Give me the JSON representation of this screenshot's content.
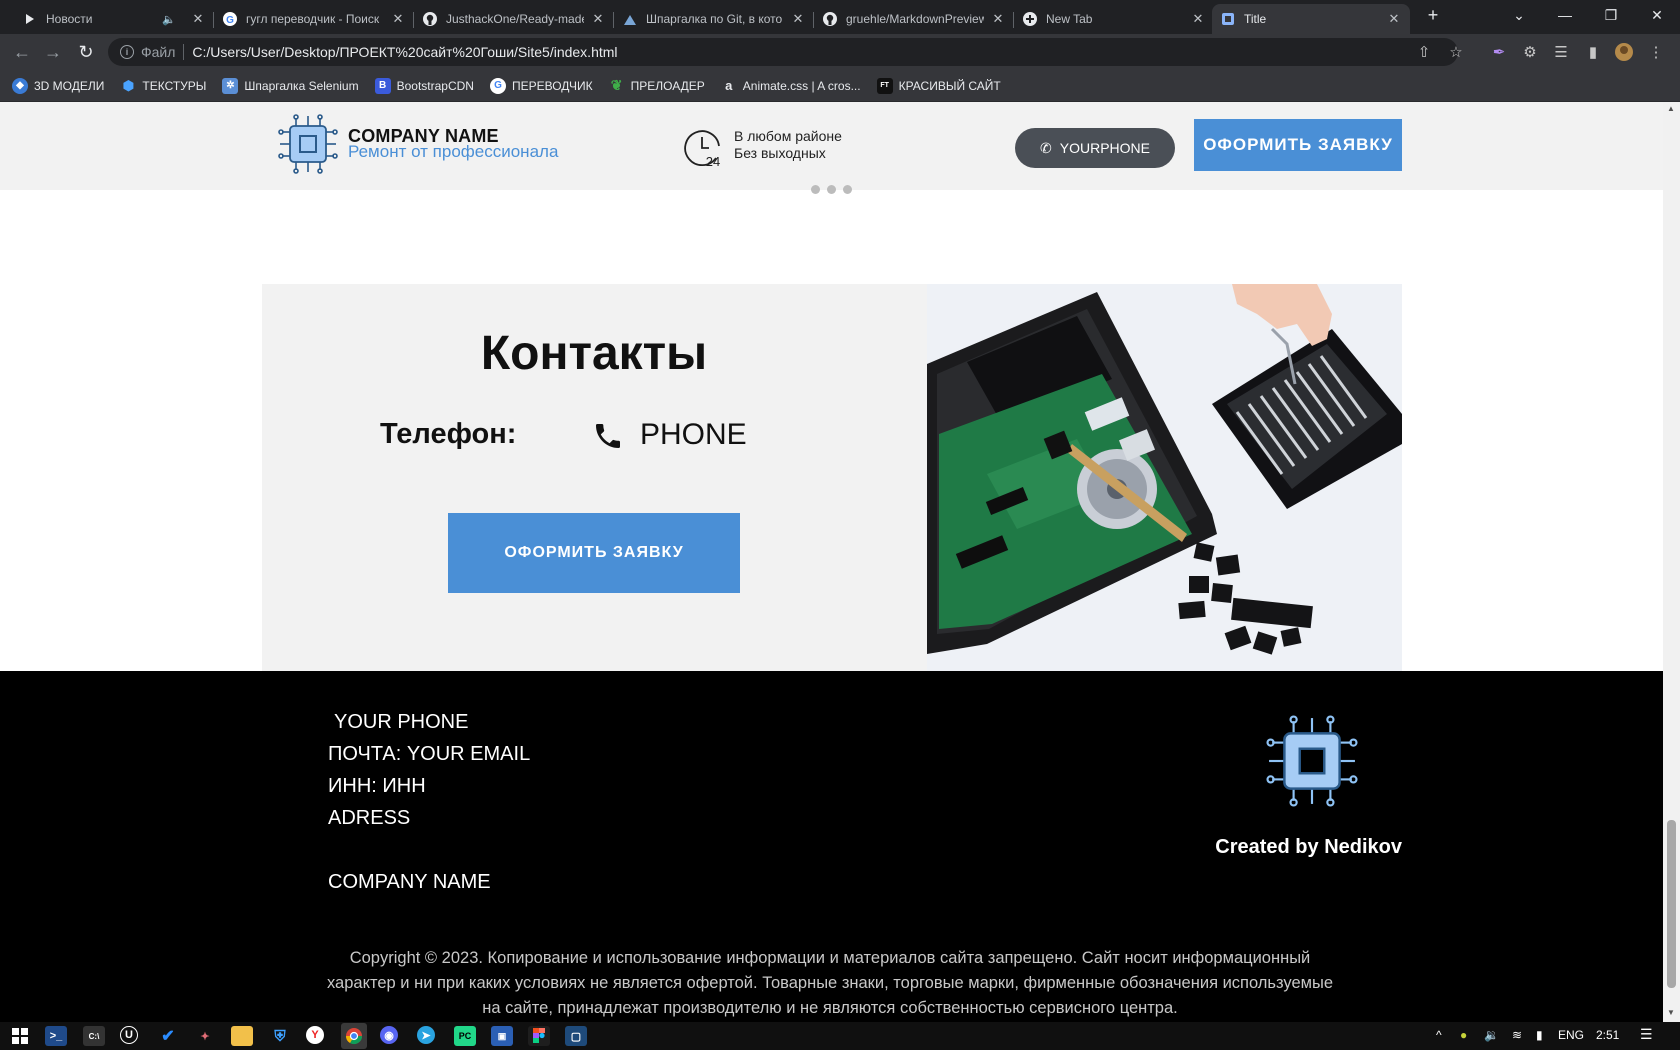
{
  "browser": {
    "tabs": [
      {
        "title": "Новости",
        "icon": "play-icon",
        "muted": true
      },
      {
        "title": "гугл переводчик - Поиск",
        "icon": "google-icon"
      },
      {
        "title": "JusthackOne/Ready-made",
        "icon": "github-icon"
      },
      {
        "title": "Шпаргалка по Git, в кото",
        "icon": "git-icon"
      },
      {
        "title": "gruehle/MarkdownPreview",
        "icon": "github-icon"
      },
      {
        "title": "New Tab",
        "icon": "new-tab-icon"
      },
      {
        "title": "Title",
        "icon": "page-icon",
        "active": true
      }
    ],
    "address": {
      "scheme_label": "Файл",
      "url": "C:/Users/User/Desktop/ПРОЕКТ%20сайт%20Гоши/Site5/index.html"
    },
    "bookmarks": [
      {
        "label": "3D МОДЕЛИ",
        "icon": "3d-icon"
      },
      {
        "label": "ТЕКСТУРЫ",
        "icon": "cube-icon"
      },
      {
        "label": "Шпаргалка Selenium",
        "icon": "selenium-icon"
      },
      {
        "label": "BootstrapCDN",
        "icon": "bootstrap-icon"
      },
      {
        "label": "ПЕРЕВОДЧИК",
        "icon": "google-icon"
      },
      {
        "label": "ПРЕЛОАДЕР",
        "icon": "leaf-icon"
      },
      {
        "label": "Animate.css | A cros...",
        "icon": "animate-icon"
      },
      {
        "label": "КРАСИВЫЙ САЙТ",
        "icon": "ft-icon"
      }
    ]
  },
  "site": {
    "header": {
      "company_name": "COMPANY NAME",
      "company_tagline": "Ремонт от профессионала",
      "hours_line1": "В любом районе",
      "hours_line2": "Без выходных",
      "clock_badge": "24",
      "phone_button": "YOURPHONE",
      "cta_button": "ОФОРМИТЬ ЗАЯВКУ"
    },
    "contacts": {
      "title": "Контакты",
      "phone_label": "Телефон:",
      "phone_value": "PHONE",
      "cta_button": "ОФОРМИТЬ ЗАЯВКУ"
    },
    "footer": {
      "phone": "YOUR PHONE",
      "email": "ПОЧТА: YOUR EMAIL",
      "inn": "ИНН: ИНН",
      "address": "ADRESS",
      "company": "COMPANY NAME",
      "created_by": "Created by Nedikov",
      "copyright": "Copyright © 2023. Копирование и использование информации и материалов сайта запрещено. Сайт носит информационный характер и ни при каких условиях не является офертой. Товарные знаки, торговые марки, фирменные обозначения используемые на сайте, принадлежат производителю и не являются собственностью сервисного центра."
    },
    "colors": {
      "accent": "#4a8fd6",
      "header_bg": "#f2f2f2",
      "footer_bg": "#000000",
      "pill": "#4a4f56"
    }
  },
  "taskbar": {
    "language": "ENG",
    "time": "2:51"
  }
}
